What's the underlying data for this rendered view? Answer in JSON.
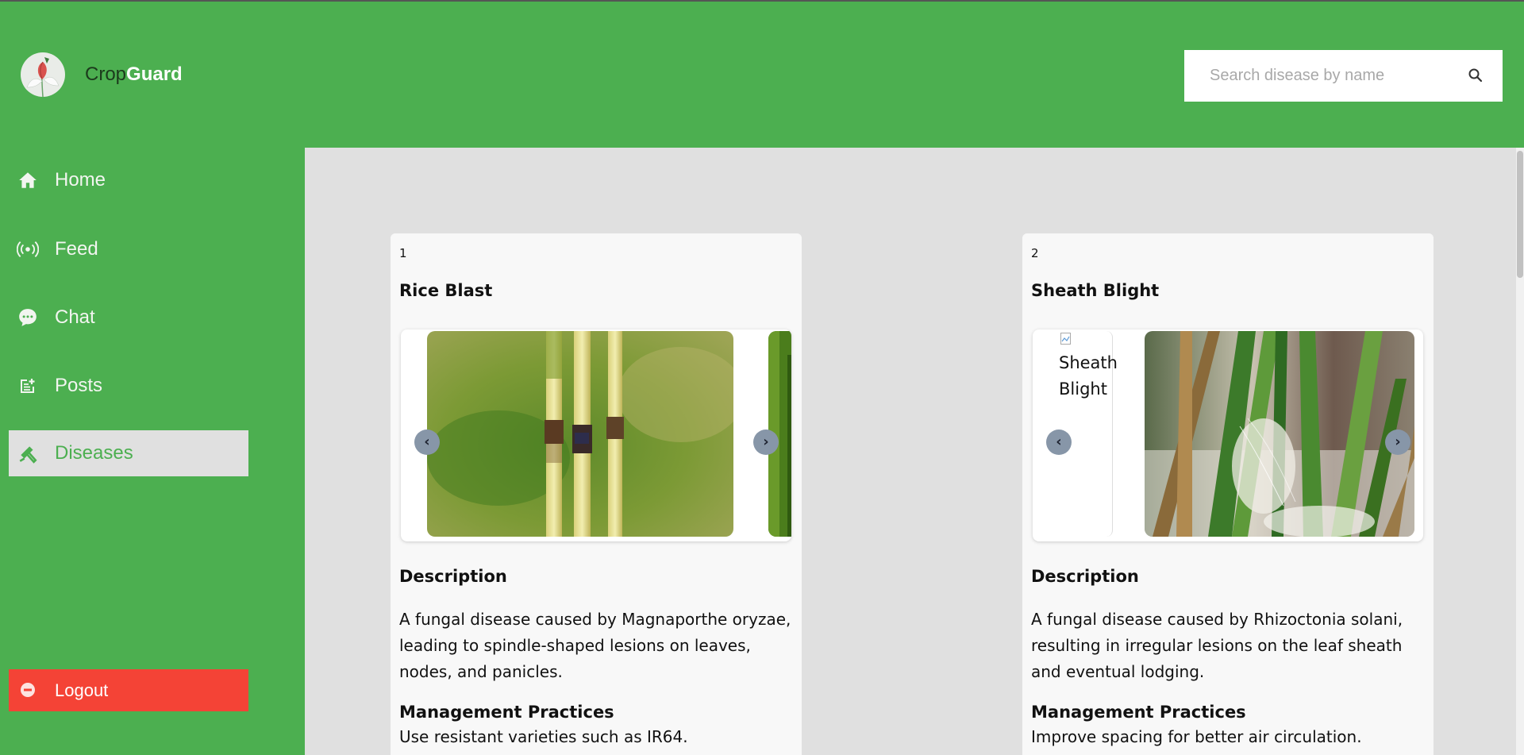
{
  "brand": {
    "part1": "Crop",
    "part2": "Guard"
  },
  "search": {
    "placeholder": "Search disease by name"
  },
  "nav": [
    {
      "label": "Home",
      "icon": "home-icon"
    },
    {
      "label": "Feed",
      "icon": "broadcast-icon"
    },
    {
      "label": "Chat",
      "icon": "chat-bubble-icon"
    },
    {
      "label": "Posts",
      "icon": "post-add-icon"
    },
    {
      "label": "Diseases",
      "icon": "disease-icon",
      "active": true
    }
  ],
  "logout": {
    "label": "Logout",
    "icon": "logout-icon"
  },
  "colors": {
    "brand_green": "#4caf50",
    "logout_red": "#f44336",
    "content_bg": "#e0e0e0"
  },
  "diseases": [
    {
      "number": "1",
      "name": "Rice Blast",
      "description_heading": "Description",
      "description": "A fungal disease caused by Magnaporthe oryzae, leading to spindle-shaped lesions on leaves, nodes, and panicles.",
      "management_heading": "Management Practices",
      "management": "Use resistant varieties such as IR64."
    },
    {
      "number": "2",
      "name": "Sheath Blight",
      "image_alt": "Sheath Blight",
      "description_heading": "Description",
      "description": "A fungal disease caused by Rhizoctonia solani, resulting in irregular lesions on the leaf sheath and eventual lodging.",
      "management_heading": "Management Practices",
      "management": "Improve spacing for better air circulation."
    }
  ]
}
